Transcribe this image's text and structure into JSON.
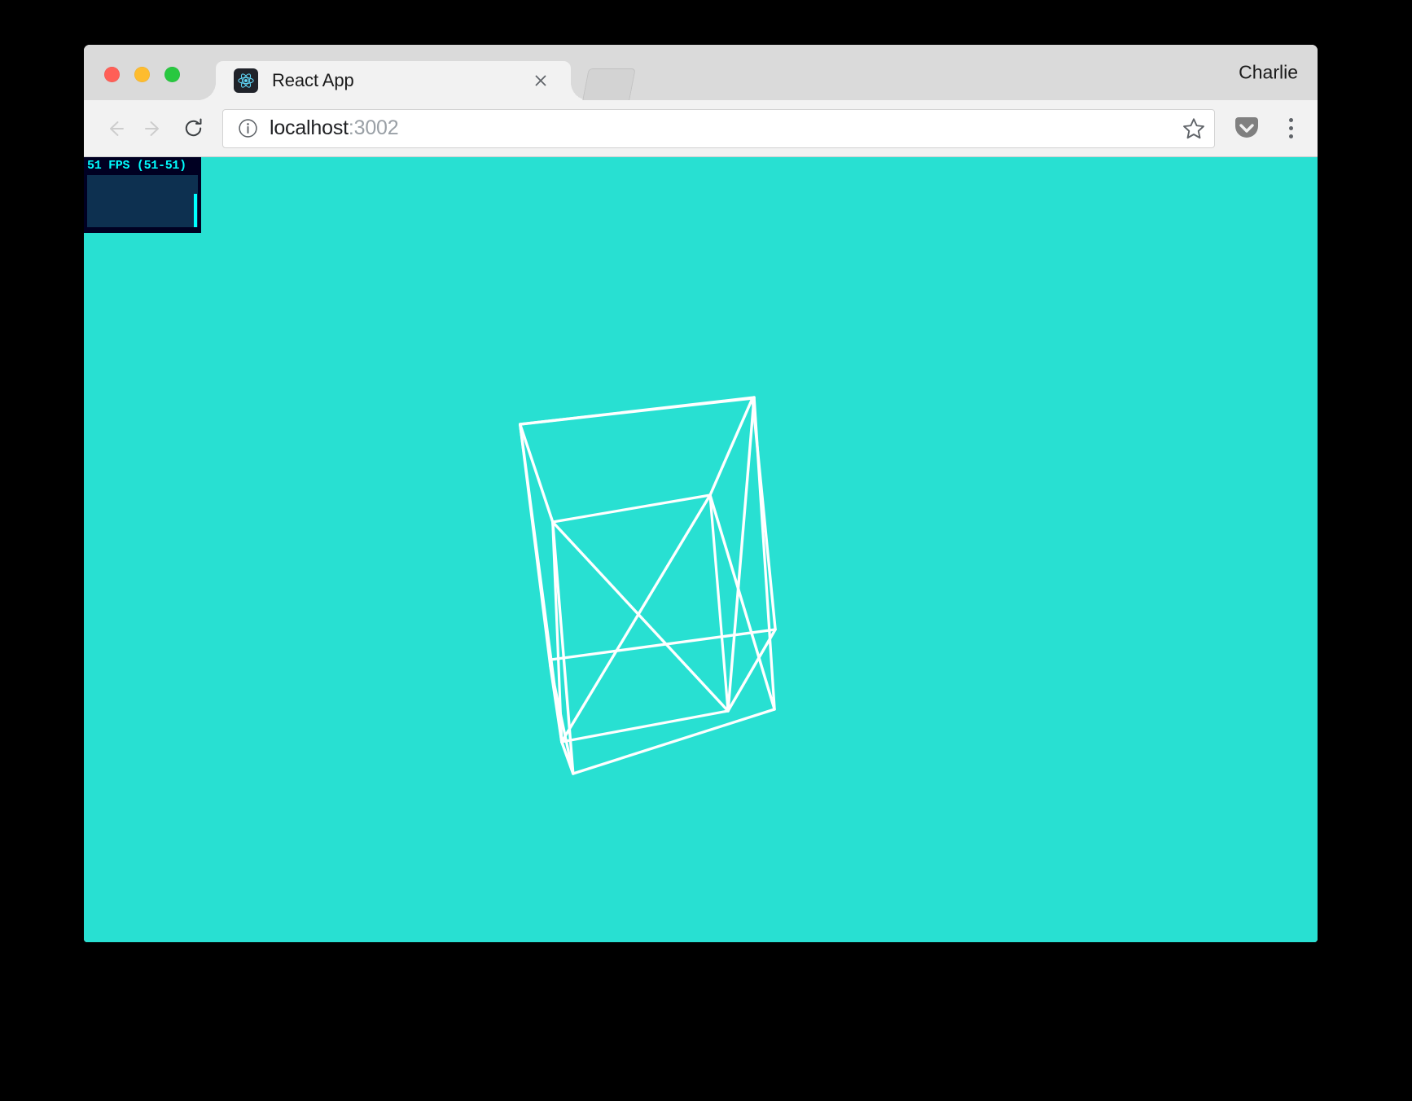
{
  "window": {
    "traffic_lights": [
      {
        "name": "close",
        "color": "#ff5f57"
      },
      {
        "name": "minimize",
        "color": "#febc2e"
      },
      {
        "name": "maximize",
        "color": "#28c840"
      }
    ]
  },
  "tabstrip": {
    "tab_title": "React App",
    "favicon_name": "react-logo-icon",
    "close_label": "×",
    "profile_name": "Charlie"
  },
  "toolbar": {
    "back_label": "←",
    "forward_label": "→",
    "reload_label": "↻",
    "site_info_label": "ⓘ",
    "url_host": "localhost",
    "url_port": ":3002",
    "url_full": "localhost:3002",
    "bookmark_label": "☆",
    "pocket_label": "Pocket",
    "menu_label": "⋮"
  },
  "page": {
    "background_color": "#28e0d2",
    "wireframe_color": "#ffffff",
    "stats": {
      "label": "51 FPS (51-51)",
      "fps_current": 51,
      "fps_min": 51,
      "fps_max": 51,
      "panel_bg": "#000022",
      "graph_bg": "#0d3050",
      "accent_color": "#00ffff"
    },
    "object": {
      "name": "rotating-wireframe-cube",
      "type": "cube-wireframe"
    }
  }
}
